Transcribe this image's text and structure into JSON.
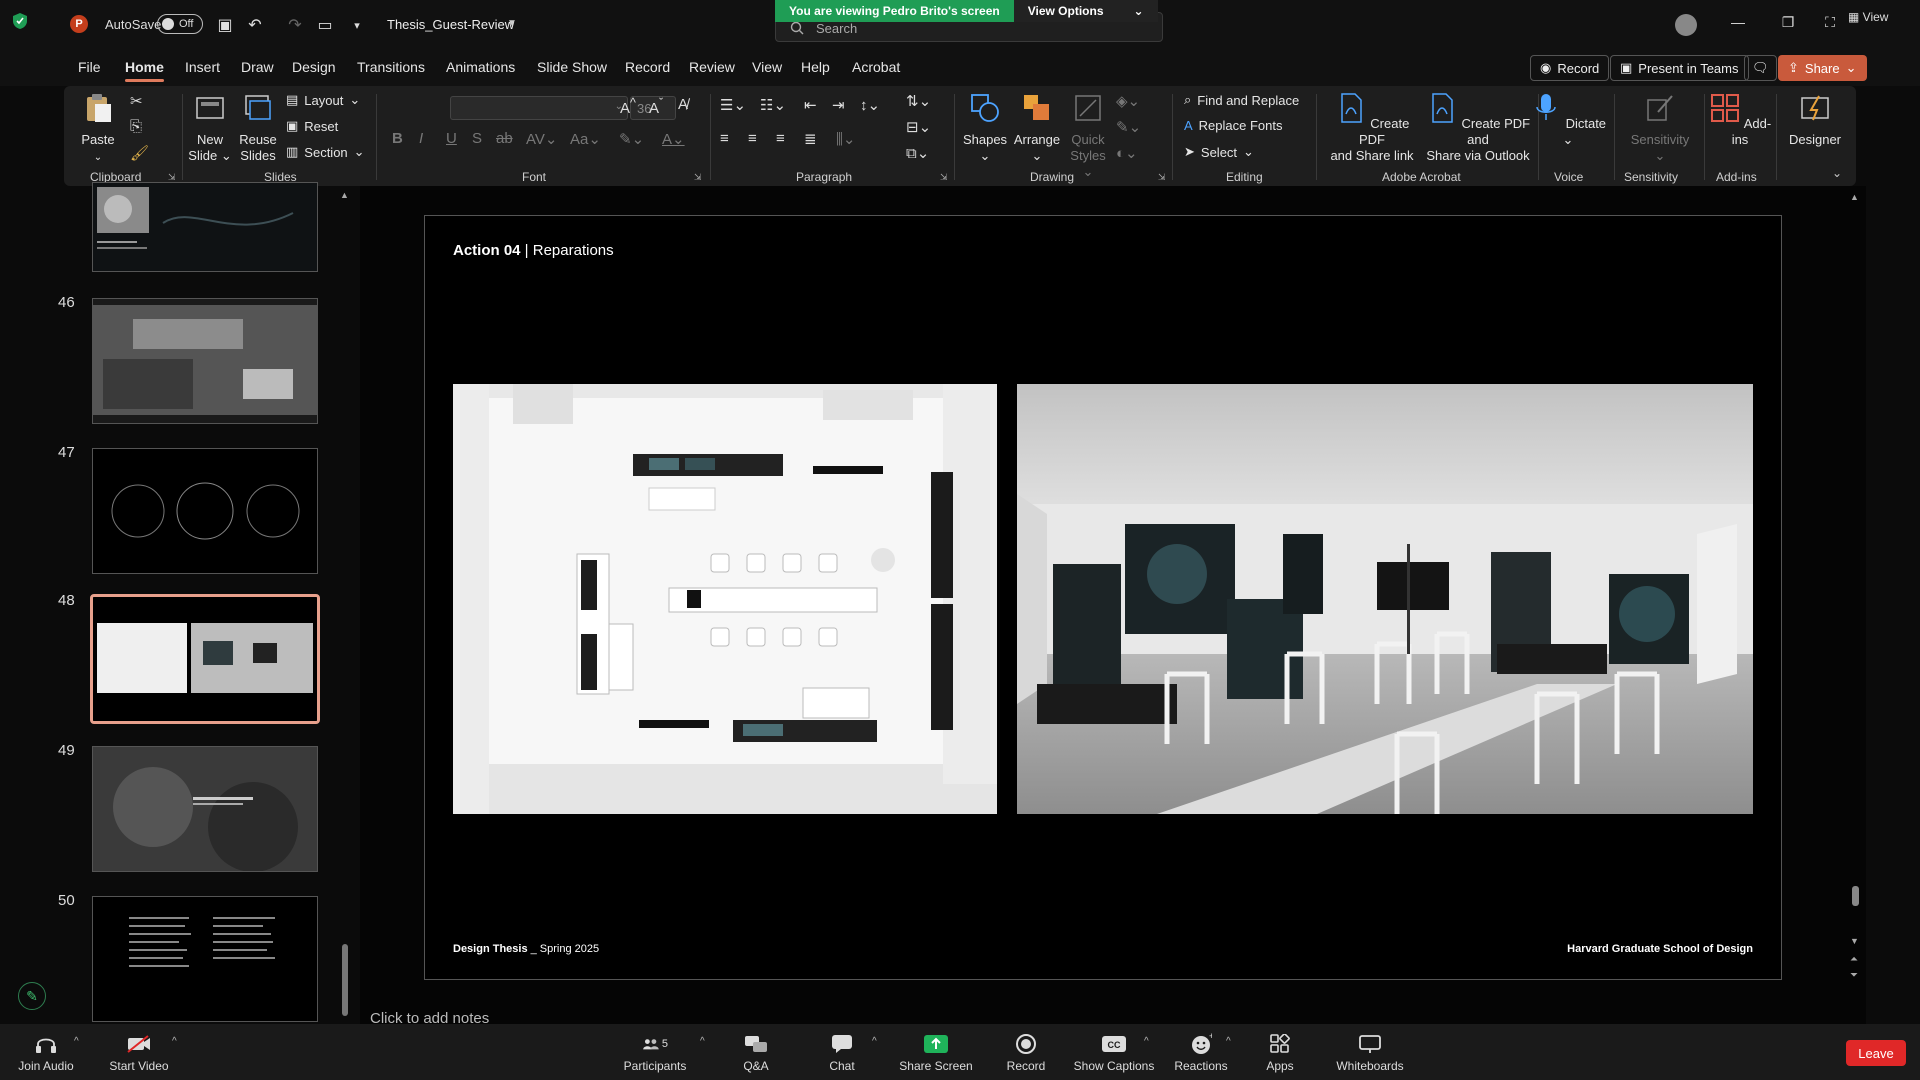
{
  "titlebar": {
    "autosave_label": "AutoSave",
    "autosave_state": "Off",
    "doc_title": "Thesis_Guest-Review",
    "view_label": "View"
  },
  "share_banner": {
    "viewing_text": "You are viewing Pedro Brito's screen",
    "view_options": "View Options"
  },
  "search": {
    "placeholder": "Search"
  },
  "menu": {
    "tabs": [
      "File",
      "Home",
      "Insert",
      "Draw",
      "Design",
      "Transitions",
      "Animations",
      "Slide Show",
      "Record",
      "Review",
      "View",
      "Help",
      "Acrobat"
    ],
    "active_tab": "Home",
    "record_btn": "Record",
    "present_btn": "Present in Teams",
    "share_btn": "Share"
  },
  "ribbon": {
    "clipboard": {
      "paste": "Paste",
      "label": "Clipboard"
    },
    "slides": {
      "new_slide_1": "New",
      "new_slide_2": "Slide",
      "reuse_1": "Reuse",
      "reuse_2": "Slides",
      "layout": "Layout",
      "reset": "Reset",
      "section": "Section",
      "label": "Slides"
    },
    "font": {
      "size": "36",
      "label": "Font"
    },
    "paragraph": {
      "label": "Paragraph"
    },
    "drawing": {
      "shapes": "Shapes",
      "arrange": "Arrange",
      "quick_styles_1": "Quick",
      "quick_styles_2": "Styles",
      "label": "Drawing"
    },
    "editing": {
      "find_replace": "Find and Replace",
      "replace_fonts": "Replace Fonts",
      "select": "Select",
      "label": "Editing"
    },
    "acrobat": {
      "pdf_link_1": "Create PDF",
      "pdf_link_2": "and Share link",
      "pdf_outlook_1": "Create PDF and",
      "pdf_outlook_2": "Share via Outlook",
      "label": "Adobe Acrobat"
    },
    "voice": {
      "dictate": "Dictate",
      "label": "Voice"
    },
    "sensitivity": {
      "btn": "Sensitivity",
      "label": "Sensitivity"
    },
    "addins": {
      "btn": "Add-ins",
      "label": "Add-ins"
    },
    "designer": {
      "btn": "Designer"
    }
  },
  "thumbnails": [
    {
      "num": "46"
    },
    {
      "num": "47"
    },
    {
      "num": "48"
    },
    {
      "num": "49"
    },
    {
      "num": "50"
    }
  ],
  "slide": {
    "title_bold": "Action 04",
    "title_rest": " | Reparations",
    "footer_left_bold": "Design Thesis",
    "footer_left_rest": " _ Spring 2025",
    "footer_right": "Harvard Graduate School of Design"
  },
  "notes_placeholder": "Click to add notes",
  "zoombar": {
    "join_audio": "Join Audio",
    "start_video": "Start Video",
    "participants": "Participants",
    "participants_count": "5",
    "qa": "Q&A",
    "chat": "Chat",
    "share_screen": "Share Screen",
    "record": "Record",
    "captions": "Show Captions",
    "reactions": "Reactions",
    "apps": "Apps",
    "whiteboards": "Whiteboards",
    "leave": "Leave"
  },
  "colors": {
    "accent": "#e07b5d",
    "zoom_green": "#1f9d55",
    "leave_red": "#e02828"
  }
}
